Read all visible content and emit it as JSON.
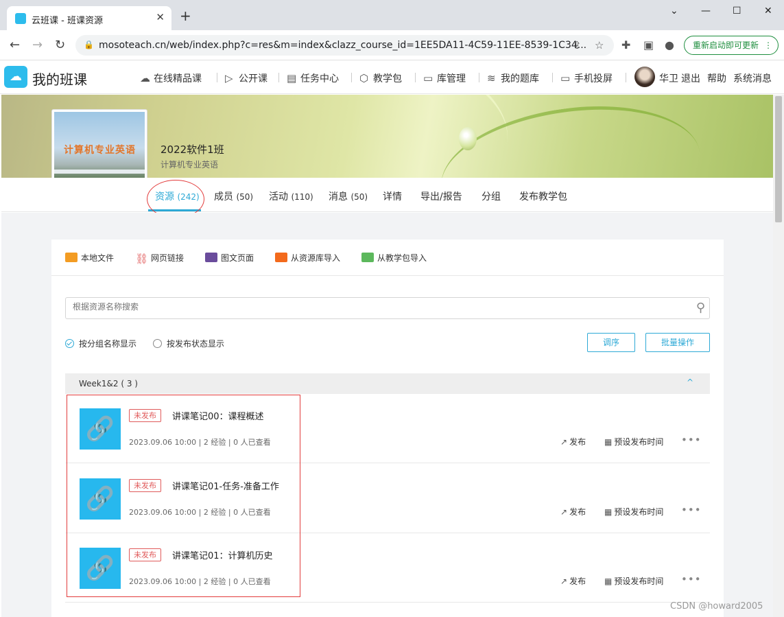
{
  "browser": {
    "tab_title": "云班课 - 班课资源",
    "tab_close": "✕",
    "new_tab": "+",
    "url": "mosoteach.cn/web/index.php?c=res&m=index&clazz_course_id=1EE5DA11-4C59-11EE-8539-1C34...",
    "update_button": "重新启动即可更新",
    "update_dots": "⋮",
    "window_controls": [
      "⌄",
      "—",
      "☐",
      "✕"
    ]
  },
  "header": {
    "logo_text": "我的班课",
    "nav": [
      {
        "label": "在线精品课",
        "icon": "cloud-icon"
      },
      {
        "label": "公开课",
        "icon": "play-icon"
      },
      {
        "label": "任务中心",
        "icon": "clipboard-icon"
      },
      {
        "label": "教学包",
        "icon": "box-icon"
      },
      {
        "label": "库管理",
        "icon": "archive-icon"
      },
      {
        "label": "我的题库",
        "icon": "layers-icon"
      },
      {
        "label": "手机投屏",
        "icon": "monitor-icon"
      }
    ],
    "user_name": "华卫",
    "logout": "退出",
    "help": "帮助",
    "messages": "系统消息"
  },
  "class_info": {
    "name": "2022软件1班",
    "subtitle": "计算机专业英语",
    "cover_text": "计算机专业英语"
  },
  "subnav": [
    {
      "label": "资源",
      "count": "(242)",
      "active": true
    },
    {
      "label": "成员",
      "count": "(50)"
    },
    {
      "label": "活动",
      "count": "(110)"
    },
    {
      "label": "消息",
      "count": "(50)"
    },
    {
      "label": "详情",
      "count": ""
    },
    {
      "label": "导出/报告",
      "count": ""
    },
    {
      "label": "分组",
      "count": ""
    },
    {
      "label": "发布教学包",
      "count": ""
    }
  ],
  "toolbar": [
    {
      "label": "本地文件",
      "icon": "folder-icon",
      "color": "#f39c23"
    },
    {
      "label": "网页链接",
      "icon": "link-icon",
      "color": "#e05a5a"
    },
    {
      "label": "图文页面",
      "icon": "article-icon",
      "color": "#6a4c9c"
    },
    {
      "label": "从资源库导入",
      "icon": "library-icon",
      "color": "#f36a1c"
    },
    {
      "label": "从教学包导入",
      "icon": "package-icon",
      "color": "#5cb85c"
    }
  ],
  "search": {
    "placeholder": "根据资源名称搜索"
  },
  "view_options": [
    {
      "label": "按分组名称显示",
      "selected": true
    },
    {
      "label": "按发布状态显示",
      "selected": false
    }
  ],
  "actions": {
    "sort": "调序",
    "batch": "批量操作"
  },
  "group": {
    "title": "Week1&2 ( 3 )",
    "caret": "^"
  },
  "resources": [
    {
      "status": "未发布",
      "title": "讲课笔记00：课程概述",
      "meta": "2023.09.06 10:00 | 2 经验 | 0 人已查看",
      "publish": "发布",
      "schedule": "预设发布时间",
      "more": "•••"
    },
    {
      "status": "未发布",
      "title": "讲课笔记01-任务-准备工作",
      "meta": "2023.09.06 10:00 | 2 经验 | 0 人已查看",
      "publish": "发布",
      "schedule": "预设发布时间",
      "more": "•••"
    },
    {
      "status": "未发布",
      "title": "讲课笔记01：计算机历史",
      "meta": "2023.09.06 10:00 | 2 经验 | 0 人已查看",
      "publish": "发布",
      "schedule": "预设发布时间",
      "more": "•••"
    }
  ],
  "watermark": "CSDN @howard2005",
  "colors": {
    "accent": "#2da9d6",
    "resource_thumb": "#27b8ee",
    "badge": "#e05a5a",
    "annotation": "#e23b3b"
  }
}
